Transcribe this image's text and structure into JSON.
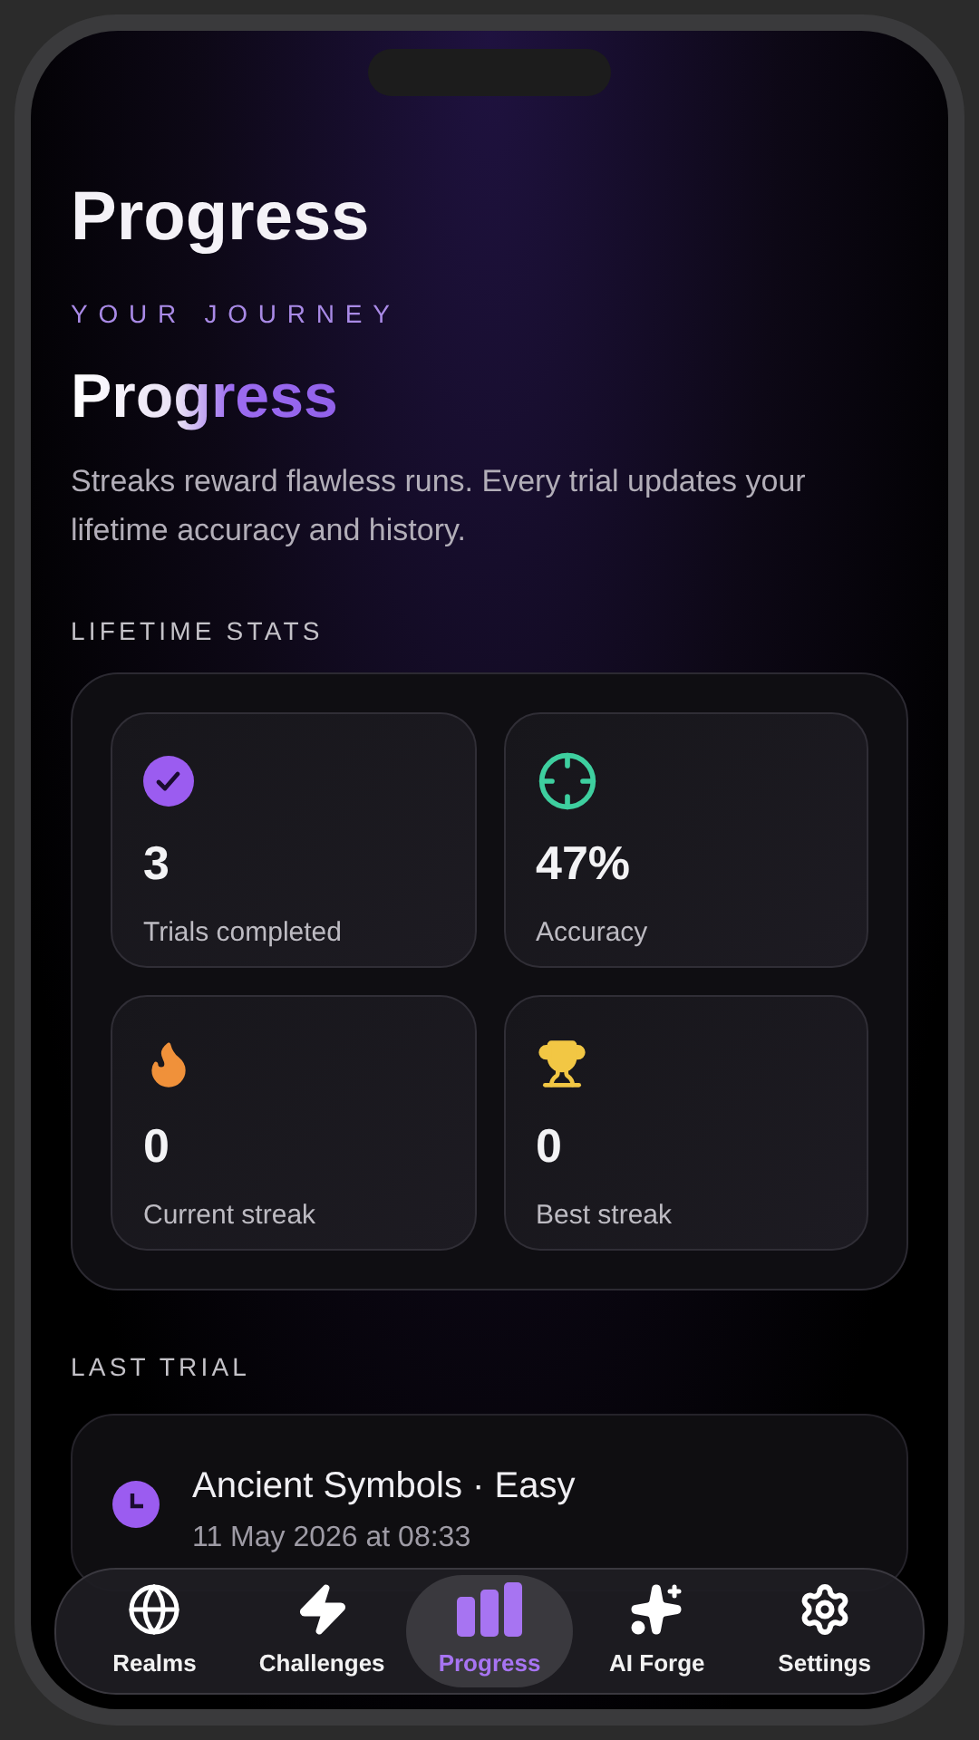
{
  "page_title": "Progress",
  "eyebrow": "YOUR JOURNEY",
  "heading": "Progress",
  "description": "Streaks reward flawless runs. Every trial updates your lifetime accuracy and history.",
  "lifetime_stats": {
    "label": "LIFETIME STATS",
    "items": [
      {
        "kind": "completed",
        "value": "3",
        "label": "Trials completed"
      },
      {
        "kind": "accuracy",
        "value": "47%",
        "label": "Accuracy"
      },
      {
        "kind": "current_streak",
        "value": "0",
        "label": "Current streak"
      },
      {
        "kind": "best_streak",
        "value": "0",
        "label": "Best streak"
      }
    ]
  },
  "last_trial": {
    "label": "LAST TRIAL",
    "title": "Ancient Symbols · Easy",
    "time": "11 May 2026 at 08:33"
  },
  "tabs": [
    {
      "kind": "realms",
      "label": "Realms",
      "selected": false
    },
    {
      "kind": "challenges",
      "label": "Challenges",
      "selected": false
    },
    {
      "kind": "progress",
      "label": "Progress",
      "selected": true
    },
    {
      "kind": "forge",
      "label": "AI Forge",
      "selected": false
    },
    {
      "kind": "settings",
      "label": "Settings",
      "selected": false
    }
  ]
}
